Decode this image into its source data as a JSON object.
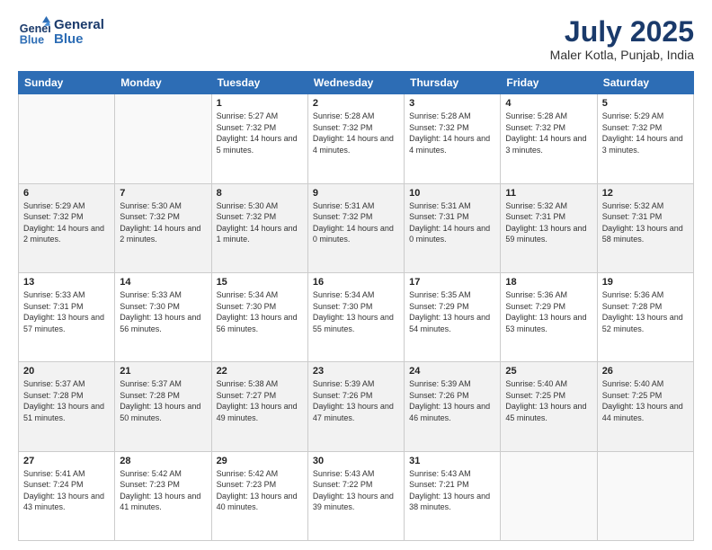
{
  "logo": {
    "line1": "General",
    "line2": "Blue"
  },
  "title": "July 2025",
  "subtitle": "Maler Kotla, Punjab, India",
  "days_of_week": [
    "Sunday",
    "Monday",
    "Tuesday",
    "Wednesday",
    "Thursday",
    "Friday",
    "Saturday"
  ],
  "weeks": [
    [
      {
        "day": "",
        "info": ""
      },
      {
        "day": "",
        "info": ""
      },
      {
        "day": "1",
        "info": "Sunrise: 5:27 AM\nSunset: 7:32 PM\nDaylight: 14 hours and 5 minutes."
      },
      {
        "day": "2",
        "info": "Sunrise: 5:28 AM\nSunset: 7:32 PM\nDaylight: 14 hours and 4 minutes."
      },
      {
        "day": "3",
        "info": "Sunrise: 5:28 AM\nSunset: 7:32 PM\nDaylight: 14 hours and 4 minutes."
      },
      {
        "day": "4",
        "info": "Sunrise: 5:28 AM\nSunset: 7:32 PM\nDaylight: 14 hours and 3 minutes."
      },
      {
        "day": "5",
        "info": "Sunrise: 5:29 AM\nSunset: 7:32 PM\nDaylight: 14 hours and 3 minutes."
      }
    ],
    [
      {
        "day": "6",
        "info": "Sunrise: 5:29 AM\nSunset: 7:32 PM\nDaylight: 14 hours and 2 minutes."
      },
      {
        "day": "7",
        "info": "Sunrise: 5:30 AM\nSunset: 7:32 PM\nDaylight: 14 hours and 2 minutes."
      },
      {
        "day": "8",
        "info": "Sunrise: 5:30 AM\nSunset: 7:32 PM\nDaylight: 14 hours and 1 minute."
      },
      {
        "day": "9",
        "info": "Sunrise: 5:31 AM\nSunset: 7:32 PM\nDaylight: 14 hours and 0 minutes."
      },
      {
        "day": "10",
        "info": "Sunrise: 5:31 AM\nSunset: 7:31 PM\nDaylight: 14 hours and 0 minutes."
      },
      {
        "day": "11",
        "info": "Sunrise: 5:32 AM\nSunset: 7:31 PM\nDaylight: 13 hours and 59 minutes."
      },
      {
        "day": "12",
        "info": "Sunrise: 5:32 AM\nSunset: 7:31 PM\nDaylight: 13 hours and 58 minutes."
      }
    ],
    [
      {
        "day": "13",
        "info": "Sunrise: 5:33 AM\nSunset: 7:31 PM\nDaylight: 13 hours and 57 minutes."
      },
      {
        "day": "14",
        "info": "Sunrise: 5:33 AM\nSunset: 7:30 PM\nDaylight: 13 hours and 56 minutes."
      },
      {
        "day": "15",
        "info": "Sunrise: 5:34 AM\nSunset: 7:30 PM\nDaylight: 13 hours and 56 minutes."
      },
      {
        "day": "16",
        "info": "Sunrise: 5:34 AM\nSunset: 7:30 PM\nDaylight: 13 hours and 55 minutes."
      },
      {
        "day": "17",
        "info": "Sunrise: 5:35 AM\nSunset: 7:29 PM\nDaylight: 13 hours and 54 minutes."
      },
      {
        "day": "18",
        "info": "Sunrise: 5:36 AM\nSunset: 7:29 PM\nDaylight: 13 hours and 53 minutes."
      },
      {
        "day": "19",
        "info": "Sunrise: 5:36 AM\nSunset: 7:28 PM\nDaylight: 13 hours and 52 minutes."
      }
    ],
    [
      {
        "day": "20",
        "info": "Sunrise: 5:37 AM\nSunset: 7:28 PM\nDaylight: 13 hours and 51 minutes."
      },
      {
        "day": "21",
        "info": "Sunrise: 5:37 AM\nSunset: 7:28 PM\nDaylight: 13 hours and 50 minutes."
      },
      {
        "day": "22",
        "info": "Sunrise: 5:38 AM\nSunset: 7:27 PM\nDaylight: 13 hours and 49 minutes."
      },
      {
        "day": "23",
        "info": "Sunrise: 5:39 AM\nSunset: 7:26 PM\nDaylight: 13 hours and 47 minutes."
      },
      {
        "day": "24",
        "info": "Sunrise: 5:39 AM\nSunset: 7:26 PM\nDaylight: 13 hours and 46 minutes."
      },
      {
        "day": "25",
        "info": "Sunrise: 5:40 AM\nSunset: 7:25 PM\nDaylight: 13 hours and 45 minutes."
      },
      {
        "day": "26",
        "info": "Sunrise: 5:40 AM\nSunset: 7:25 PM\nDaylight: 13 hours and 44 minutes."
      }
    ],
    [
      {
        "day": "27",
        "info": "Sunrise: 5:41 AM\nSunset: 7:24 PM\nDaylight: 13 hours and 43 minutes."
      },
      {
        "day": "28",
        "info": "Sunrise: 5:42 AM\nSunset: 7:23 PM\nDaylight: 13 hours and 41 minutes."
      },
      {
        "day": "29",
        "info": "Sunrise: 5:42 AM\nSunset: 7:23 PM\nDaylight: 13 hours and 40 minutes."
      },
      {
        "day": "30",
        "info": "Sunrise: 5:43 AM\nSunset: 7:22 PM\nDaylight: 13 hours and 39 minutes."
      },
      {
        "day": "31",
        "info": "Sunrise: 5:43 AM\nSunset: 7:21 PM\nDaylight: 13 hours and 38 minutes."
      },
      {
        "day": "",
        "info": ""
      },
      {
        "day": "",
        "info": ""
      }
    ]
  ]
}
